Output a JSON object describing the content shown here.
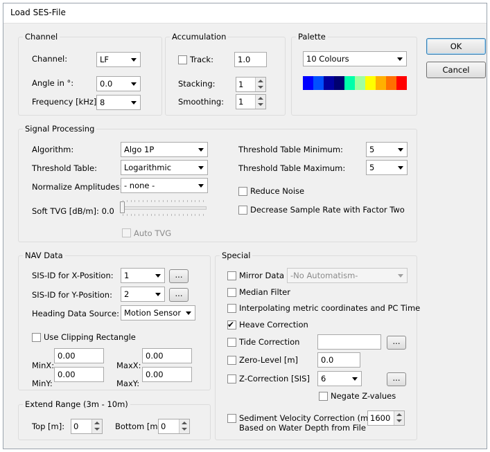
{
  "window": {
    "title": "Load SES-File"
  },
  "buttons": {
    "ok": "OK",
    "cancel": "Cancel",
    "ellipsis": "..."
  },
  "channel": {
    "legend": "Channel",
    "channel_label": "Channel:",
    "channel_value": "LF",
    "angle_label": "Angle in °:",
    "angle_value": "0.0",
    "frequency_label": "Frequency [kHz]:",
    "frequency_value": "8"
  },
  "accumulation": {
    "legend": "Accumulation",
    "track_label": "Track:",
    "track_checked": false,
    "track_value": "1.0",
    "stacking_label": "Stacking:",
    "stacking_value": "1",
    "smoothing_label": "Smoothing:",
    "smoothing_value": "1"
  },
  "palette": {
    "legend": "Palette",
    "value": "10 Colours",
    "colors": [
      "#0000ff",
      "#0050ff",
      "#0000a0",
      "#000070",
      "#00ffaa",
      "#a0ffa0",
      "#ffff00",
      "#ffb000",
      "#ff7000",
      "#ff0000"
    ]
  },
  "signal": {
    "legend": "Signal Processing",
    "algorithm_label": "Algorithm:",
    "algorithm_value": "Algo 1P",
    "threshold_label": "Threshold Table:",
    "threshold_value": "Logarithmic",
    "normalize_label": "Normalize Amplitudes:",
    "normalize_value": "- none -",
    "soft_tvg_label": "Soft TVG [dB/m]: 0.0",
    "soft_tvg_level": 0,
    "auto_tvg_label": "Auto TVG",
    "auto_tvg_checked": false,
    "tmin_label": "Threshold Table Minimum:",
    "tmin_value": "5",
    "tmax_label": "Threshold Table Maximum:",
    "tmax_value": "5",
    "reduce_noise_label": "Reduce Noise",
    "reduce_noise_checked": false,
    "decrease_rate_label": "Decrease Sample Rate with Factor Two",
    "decrease_rate_checked": false
  },
  "nav": {
    "legend": "NAV Data",
    "sisx_label": "SIS-ID for X-Position:",
    "sisx_value": "1",
    "sisy_label": "SIS-ID for Y-Position:",
    "sisy_value": "2",
    "heading_label": "Heading Data Source:",
    "heading_value": "Motion Sensor",
    "clip_label": "Use Clipping Rectangle",
    "clip_checked": false,
    "minx_label": "MinX:",
    "minx_value": "0.00",
    "maxx_label": "MaxX:",
    "maxx_value": "0.00",
    "miny_label": "MinY:",
    "miny_value": "0.00",
    "maxy_label": "MaxY:",
    "maxy_value": "0.00"
  },
  "extend": {
    "legend": "Extend Range (3m - 10m)",
    "top_label": "Top [m]:",
    "top_value": "0",
    "bottom_label": "Bottom [m]:",
    "bottom_value": "0"
  },
  "special": {
    "legend": "Special",
    "mirror_label": "Mirror Data",
    "mirror_checked": false,
    "mirror_value": "-No Automatism-",
    "median_label": "Median Filter",
    "median_checked": false,
    "interp_label": "Interpolating metric coordinates and PC Time",
    "interp_checked": false,
    "heave_label": "Heave Correction",
    "heave_checked": true,
    "tide_label": "Tide Correction",
    "tide_checked": false,
    "tide_value": "",
    "zero_label": "Zero-Level [m]",
    "zero_checked": false,
    "zero_value": "0.0",
    "zcorr_label": "Z-Correction [SIS]",
    "zcorr_checked": false,
    "zcorr_value": "6",
    "negate_label": "Negate Z-values",
    "negate_checked": false,
    "sediment_label_1": "Sediment Velocity Correction (m/s)",
    "sediment_label_2": "Based on Water Depth from File",
    "sediment_checked": false,
    "sediment_value": "1600"
  }
}
